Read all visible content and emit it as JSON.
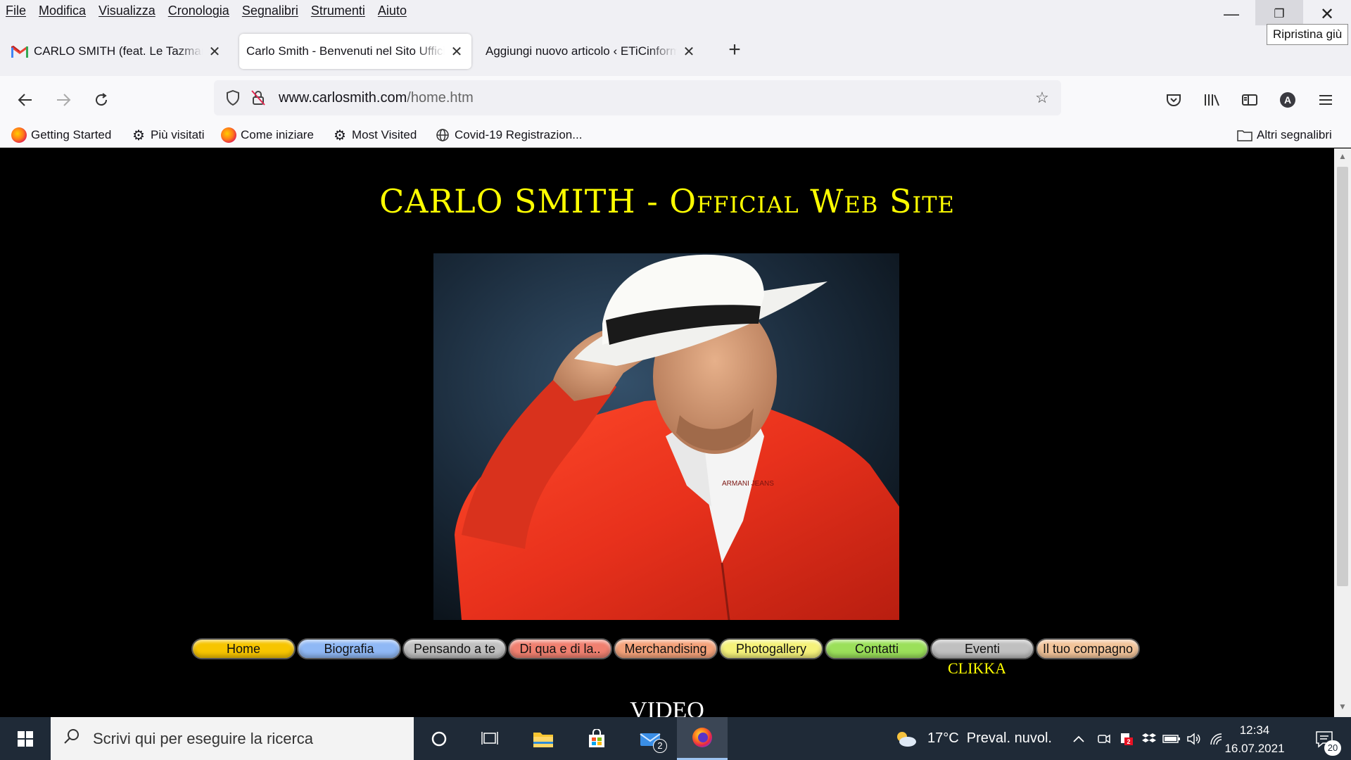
{
  "menubar": {
    "items": [
      "File",
      "Modifica",
      "Visualizza",
      "Cronologia",
      "Segnalibri",
      "Strumenti",
      "Aiuto"
    ],
    "tooltip": "Ripristina giù"
  },
  "tabs": [
    {
      "title": "CARLO SMITH (feat. Le Tazmania",
      "icon": "gmail-icon",
      "active": false
    },
    {
      "title": "Carlo Smith - Benvenuti nel Sito Ufficiale",
      "active": true
    },
    {
      "title": "Aggiungi nuovo articolo ‹ ETiCinformazione",
      "active": false
    }
  ],
  "navbar": {
    "url_domain": "www.carlosmith.com",
    "url_path": "/home.htm"
  },
  "bookmarks": {
    "items": [
      {
        "label": "Getting Started",
        "icon": "firefox-icon"
      },
      {
        "label": "Più visitati",
        "icon": "gear-icon"
      },
      {
        "label": "Come iniziare",
        "icon": "firefox-icon"
      },
      {
        "label": "Most Visited",
        "icon": "gear-icon"
      },
      {
        "label": "Covid-19 Registrazion...",
        "icon": "globe-icon"
      }
    ],
    "other": "Altri segnalibri"
  },
  "page": {
    "title": "CARLO SMITH - Official Web Site",
    "nav": [
      {
        "label": "Home",
        "color": "#f7c500"
      },
      {
        "label": "Biografia",
        "color": "#8fb8f5"
      },
      {
        "label": "Pensando a te",
        "color": "#c0c0c0"
      },
      {
        "label": "Di qua e di la..",
        "color": "#f08070"
      },
      {
        "label": "Merchandising",
        "color": "#f4a27a"
      },
      {
        "label": "Photogallery",
        "color": "#f5f27a"
      },
      {
        "label": "Contatti",
        "color": "#9be05a"
      },
      {
        "label": "Eventi",
        "color": "#c0c0c0"
      },
      {
        "label": "Il tuo compagno",
        "color": "#f2c49a"
      }
    ],
    "clikka": "CLIKKA",
    "video_heading": "VIDEO"
  },
  "taskbar": {
    "search_placeholder": "Scrivi qui per eseguire la ricerca",
    "mail_badge": "2",
    "weather": "17°C  Preval. nuvol.",
    "time": "12:34",
    "date": "16.07.2021",
    "notifications": "20"
  }
}
